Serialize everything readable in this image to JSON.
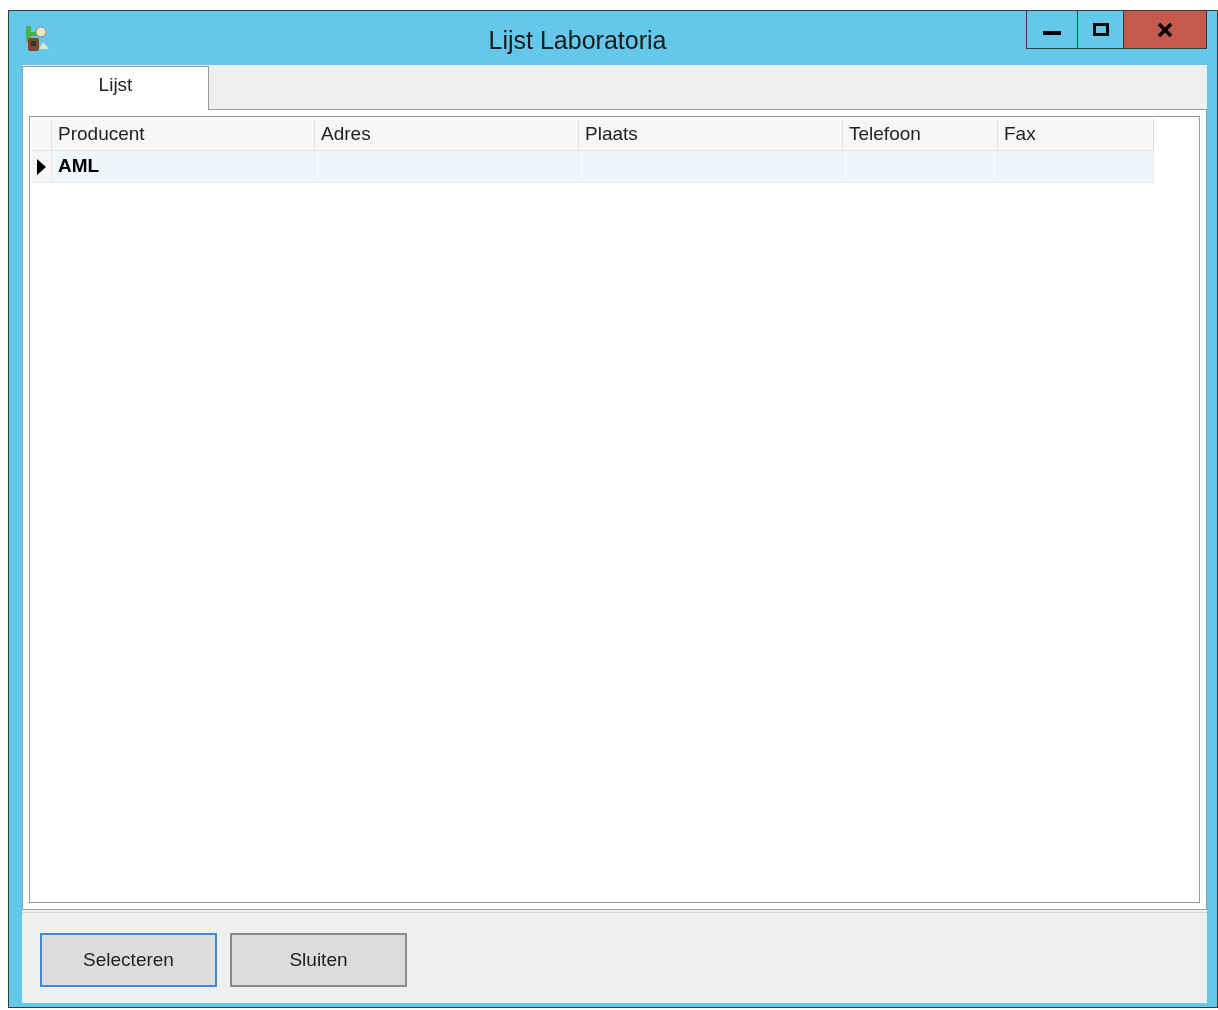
{
  "window": {
    "title": "Lijst Laboratoria"
  },
  "tabs": [
    {
      "label": "Lijst",
      "selected": true
    }
  ],
  "table": {
    "columns": [
      "Producent",
      "Adres",
      "Plaats",
      "Telefoon",
      "Fax"
    ],
    "rows": [
      {
        "selected": true,
        "cells": [
          "AML",
          "",
          "",
          "",
          ""
        ]
      }
    ]
  },
  "buttons": [
    {
      "label": "Selecteren",
      "focused": true
    },
    {
      "label": "Sluiten",
      "focused": false
    }
  ]
}
